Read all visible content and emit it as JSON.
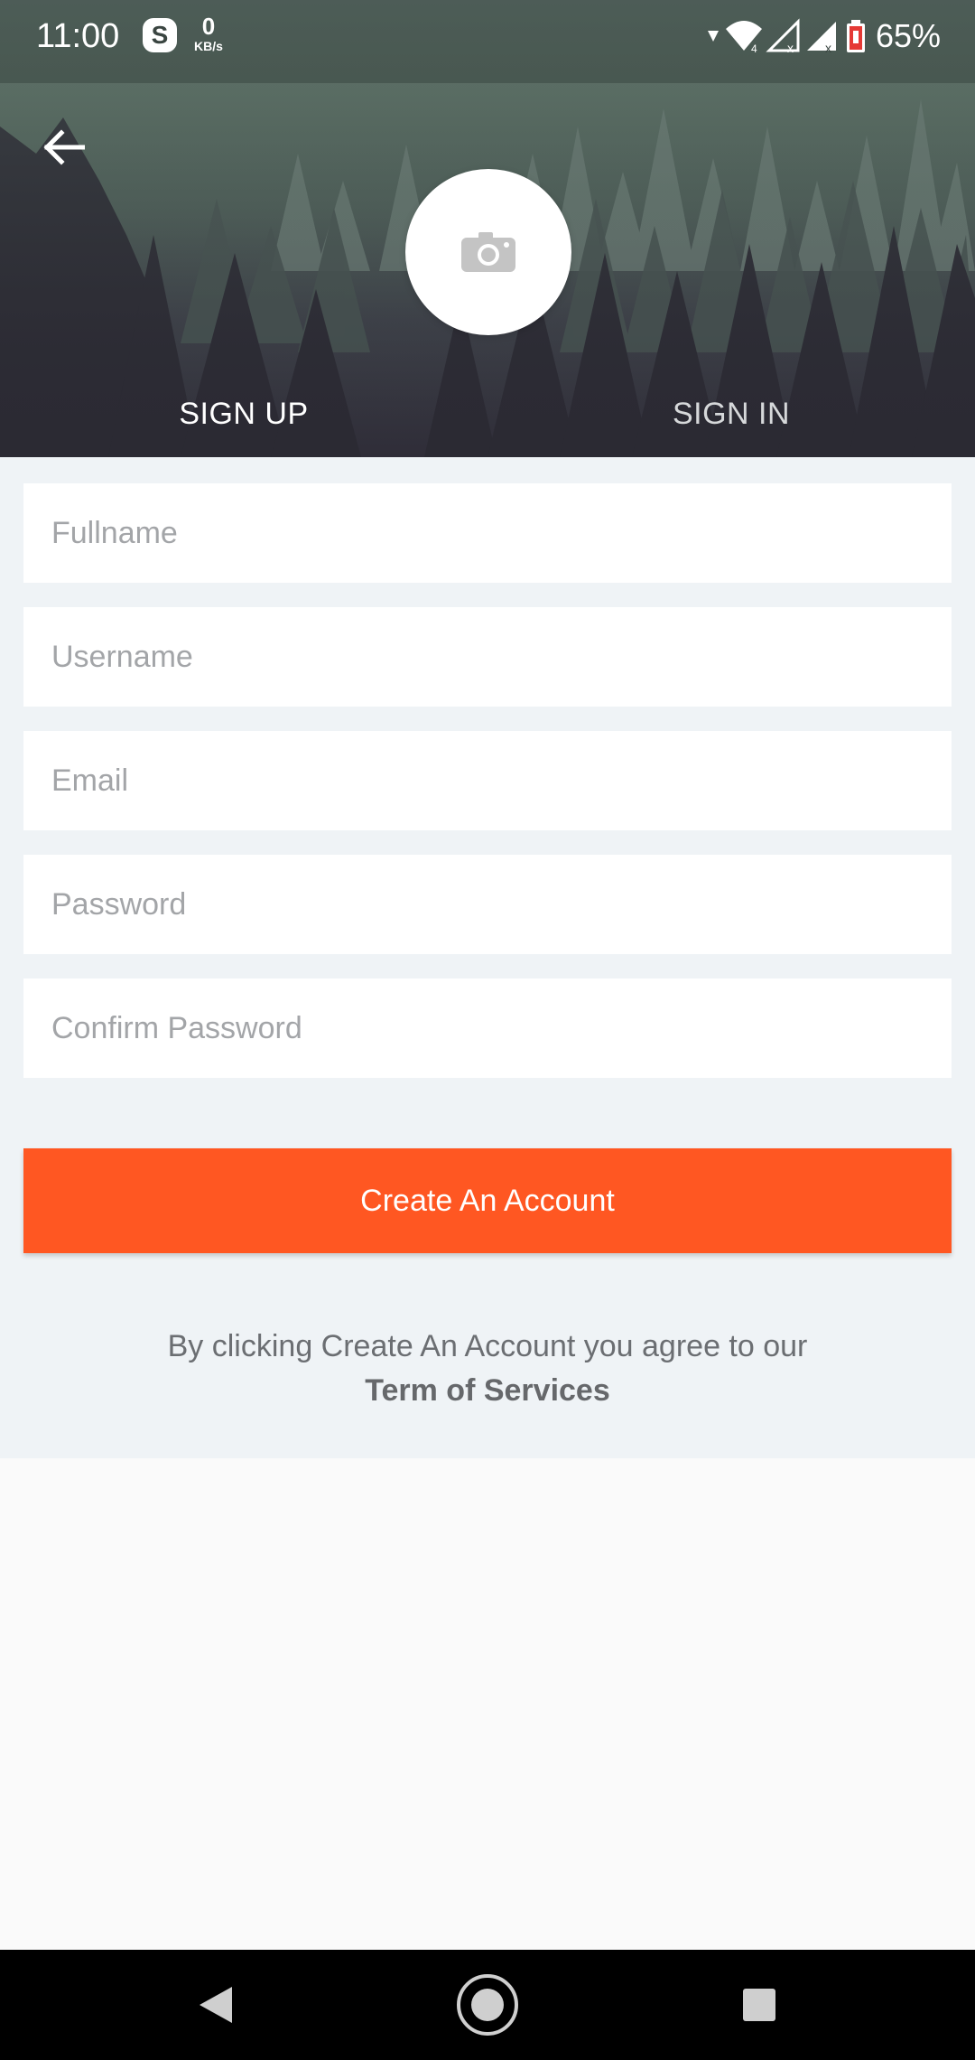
{
  "status_bar": {
    "time": "11:00",
    "skype_letter": "S",
    "net_speed_value": "0",
    "net_speed_unit": "KB/s",
    "battery_percent": "65%"
  },
  "header": {
    "tabs": [
      {
        "label": "SIGN UP",
        "active": true
      },
      {
        "label": "SIGN IN",
        "active": false
      }
    ]
  },
  "form": {
    "fields": [
      {
        "placeholder": "Fullname",
        "value": ""
      },
      {
        "placeholder": "Username",
        "value": ""
      },
      {
        "placeholder": "Email",
        "value": ""
      },
      {
        "placeholder": "Password",
        "value": ""
      },
      {
        "placeholder": "Confirm Password",
        "value": ""
      }
    ],
    "submit_label": "Create An Account",
    "terms_text": "By clicking Create An Account you agree to our",
    "terms_link": "Term of Services"
  },
  "colors": {
    "accent": "#ff5722",
    "form_background": "#eff3f6",
    "page_background": "#fafafa",
    "navbar": "#000000"
  },
  "icons": {
    "back": "arrow-left-icon",
    "avatar": "camera-icon",
    "nav_back": "triangle-back-icon",
    "nav_home": "circle-home-icon",
    "nav_recents": "square-recents-icon"
  }
}
